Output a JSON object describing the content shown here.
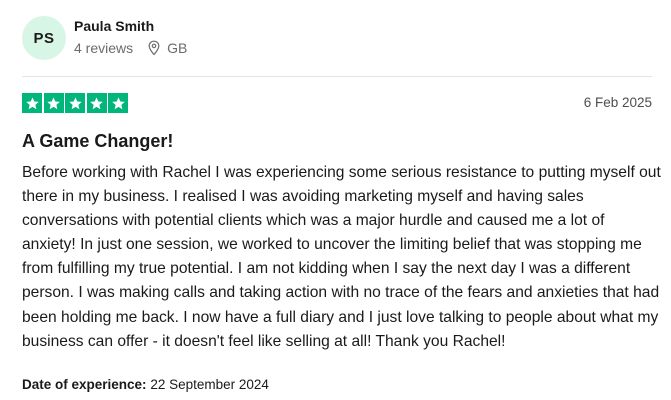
{
  "reviewer": {
    "initials": "PS",
    "name": "Paula Smith",
    "reviews": "4 reviews",
    "location": "GB",
    "avatar_bg": "#d7f6e6"
  },
  "review": {
    "rating": 5,
    "rating_max": 5,
    "star_color": "#00b67a",
    "date": "6 Feb 2025",
    "title": "A Game Changer!",
    "body": "Before working with Rachel I was experiencing some serious resistance to putting myself out there in my business. I realised I was avoiding marketing myself and having sales conversations with potential clients which was a major hurdle and caused me a lot of anxiety! In just one session, we worked to uncover the limiting belief that was stopping me from fulfilling my true potential. I am not kidding when I say the next day I was a different person. I was making calls and taking action with no trace of the fears and anxieties that had been holding me back. I now have a full diary and I just love talking to people about what my business can offer - it doesn't feel like selling at all! Thank you Rachel!",
    "experience_label": "Date of experience:",
    "experience_date": "22 September 2024"
  },
  "icons": {
    "location": "map-pin-icon",
    "star": "star-icon"
  }
}
